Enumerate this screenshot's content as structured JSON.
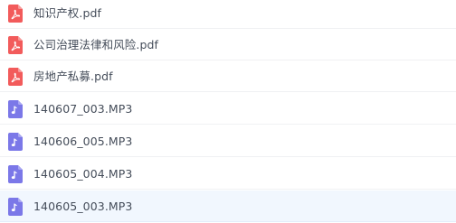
{
  "colors": {
    "pdf_icon": "#f25b5b",
    "audio_icon": "#7b78e8",
    "text": "#454d5a",
    "selected_row": "#f1f7fe",
    "divider": "#f0f1f3"
  },
  "files": [
    {
      "name": "知识产权.pdf",
      "type": "pdf",
      "icon": "pdf-file-icon"
    },
    {
      "name": "公司治理法律和风险.pdf",
      "type": "pdf",
      "icon": "pdf-file-icon"
    },
    {
      "name": "房地产私募.pdf",
      "type": "pdf",
      "icon": "pdf-file-icon"
    },
    {
      "name": "140607_003.MP3",
      "type": "audio",
      "icon": "audio-file-icon"
    },
    {
      "name": "140606_005.MP3",
      "type": "audio",
      "icon": "audio-file-icon"
    },
    {
      "name": "140605_004.MP3",
      "type": "audio",
      "icon": "audio-file-icon"
    },
    {
      "name": "140605_003.MP3",
      "type": "audio",
      "icon": "audio-file-icon",
      "selected": true
    }
  ]
}
